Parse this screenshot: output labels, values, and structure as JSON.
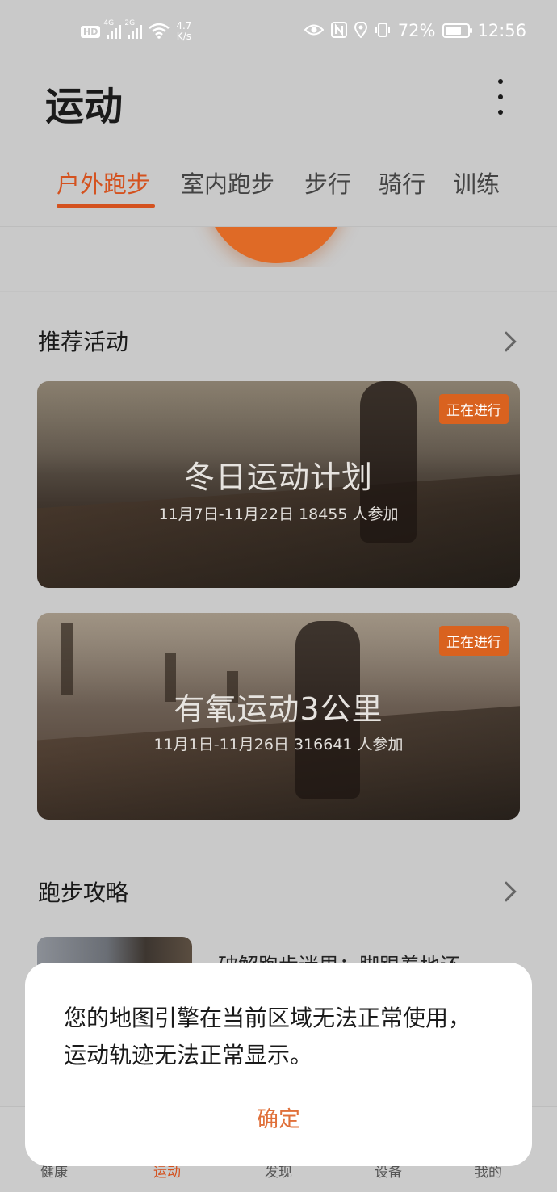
{
  "status_bar": {
    "hd": "HD",
    "net1": "4G",
    "net2": "2G",
    "speed_value": "4.7",
    "speed_unit": "K/s",
    "battery": "72%",
    "battery_level": 0.72,
    "time": "12:56"
  },
  "header": {
    "title": "运动"
  },
  "tabs": [
    {
      "label": "户外跑步",
      "active": true
    },
    {
      "label": "室内跑步",
      "active": false
    },
    {
      "label": "步行",
      "active": false
    },
    {
      "label": "骑行",
      "active": false
    },
    {
      "label": "训练",
      "active": false
    }
  ],
  "recommended": {
    "title": "推荐活动",
    "cards": [
      {
        "badge": "正在进行",
        "title": "冬日运动计划",
        "meta": "11月7日-11月22日   18455 人参加"
      },
      {
        "badge": "正在进行",
        "title": "有氧运动3公里",
        "meta": "11月1日-11月26日  316641 人参加"
      }
    ]
  },
  "guide": {
    "title": "跑步攻略",
    "article_title": "破解跑步迷思：脚跟着地还"
  },
  "bottom_nav": [
    {
      "label": "健康",
      "active": false
    },
    {
      "label": "运动",
      "active": true
    },
    {
      "label": "发现",
      "active": false
    },
    {
      "label": "设备",
      "active": false
    },
    {
      "label": "我的",
      "active": false
    }
  ],
  "dialog": {
    "message": "您的地图引擎在当前区域无法正常使用，运动轨迹无法正常显示。",
    "confirm": "确定"
  },
  "colors": {
    "accent": "#d4521f",
    "badge": "#d9621f",
    "background": "#c9c9c9"
  }
}
